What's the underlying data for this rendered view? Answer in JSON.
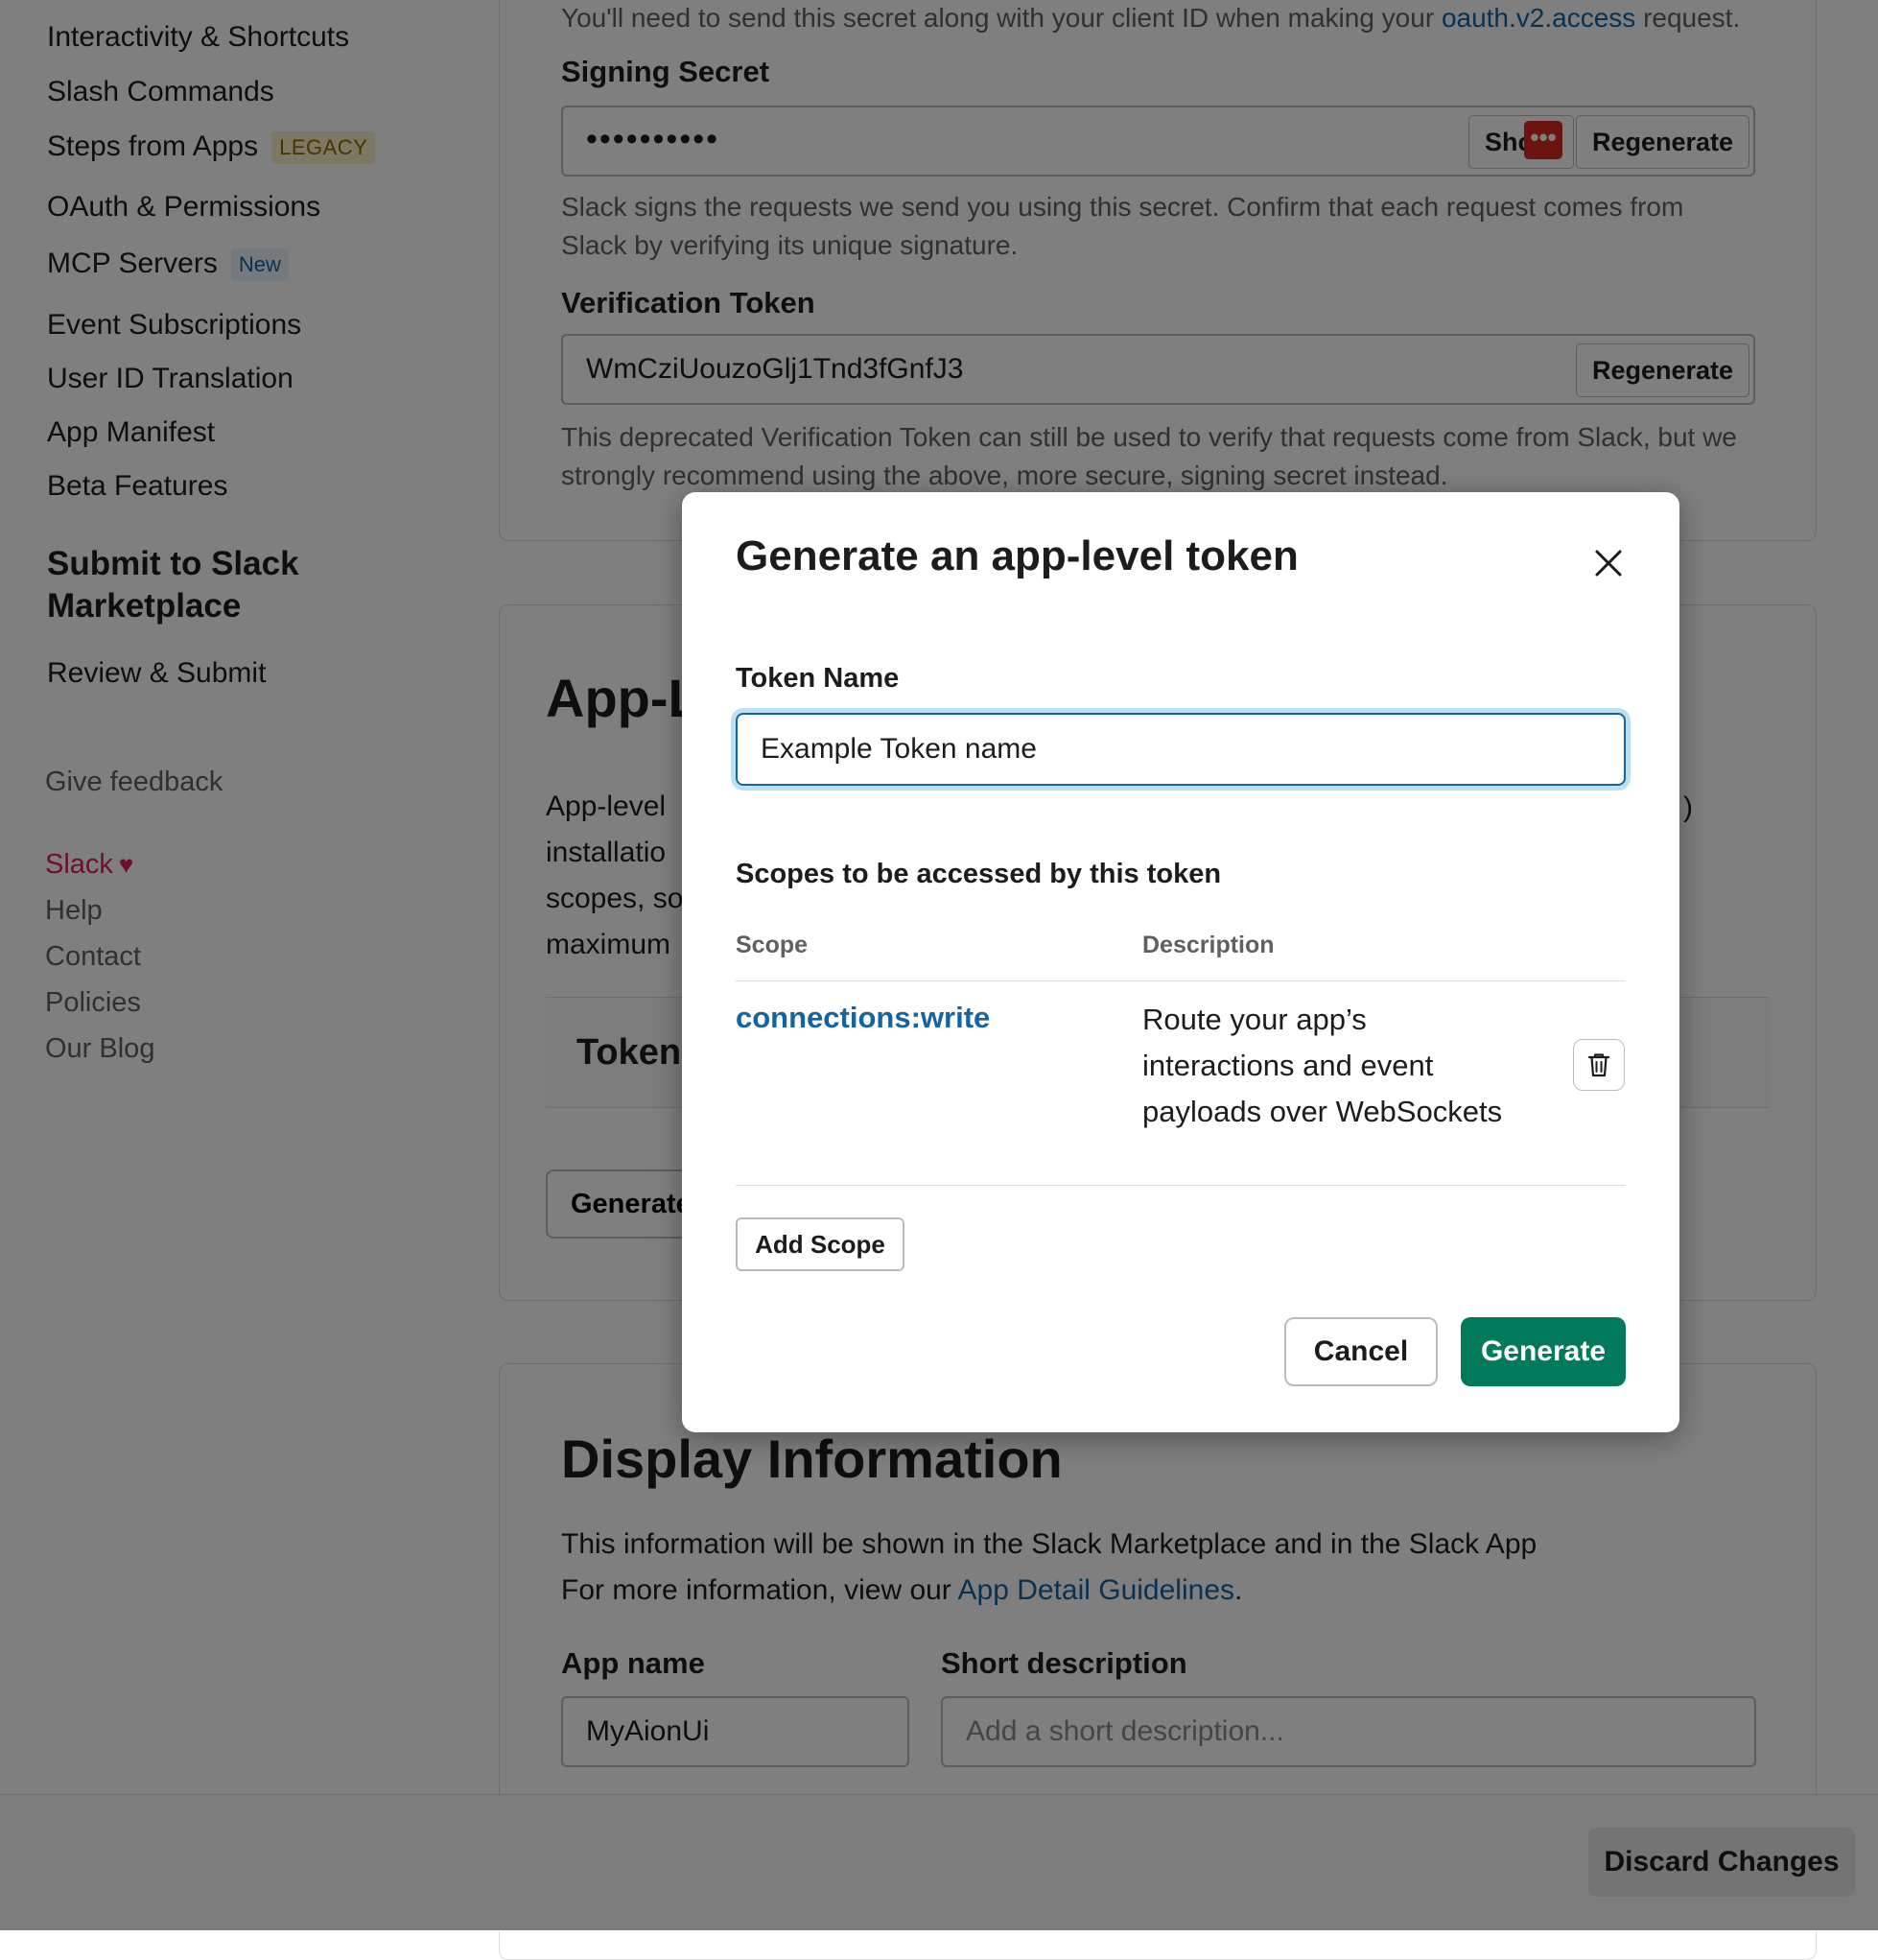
{
  "sidebar": {
    "items": [
      {
        "label": "Interactivity & Shortcuts"
      },
      {
        "label": "Slash Commands"
      },
      {
        "label": "Steps from Apps",
        "badge": "LEGACY"
      },
      {
        "label": "OAuth & Permissions"
      },
      {
        "label": "MCP Servers",
        "badge": "New"
      },
      {
        "label": "Event Subscriptions"
      },
      {
        "label": "User ID Translation"
      },
      {
        "label": "App Manifest"
      },
      {
        "label": "Beta Features"
      }
    ],
    "section_heading": "Submit to Slack Marketplace",
    "section_items": [
      {
        "label": "Review & Submit"
      }
    ],
    "feedback": "Give feedback",
    "footer": {
      "brand": "Slack",
      "links": [
        "Help",
        "Contact",
        "Policies",
        "Our Blog"
      ]
    }
  },
  "credentials": {
    "intro_text": "You'll need to send this secret along with your client ID when making your",
    "intro_link": "oauth.v2.access",
    "intro_suffix": "request.",
    "signing_secret": {
      "label": "Signing Secret",
      "value": "••••••••••",
      "show_label": "Show",
      "regenerate_label": "Regenerate",
      "help": "Slack signs the requests we send you using this secret. Confirm that each request comes from Slack by verifying its unique signature."
    },
    "verification_token": {
      "label": "Verification Token",
      "value": "WmCziUouzoGlj1Tnd3fGnfJ3",
      "regenerate_label": "Regenerate",
      "help": "This deprecated Verification Token can still be used to verify that requests come from Slack, but we strongly recommend using the above, more secure, signing secret instead."
    }
  },
  "app_level_tokens": {
    "title": "App-L",
    "body_lines": [
      "App-level",
      "installatio",
      "scopes, so",
      "maximum"
    ],
    "right_fragment": ")",
    "table_header": "Token",
    "generate_label": "Generate"
  },
  "display_info": {
    "title": "Display Information",
    "line1": "This information will be shown in the Slack Marketplace and in the Slack App",
    "line2_prefix": "For more information, view our",
    "line2_link": "App Detail Guidelines",
    "line2_suffix": ".",
    "app_name_label": "App name",
    "app_name_value": "MyAionUi",
    "short_desc_label": "Short description",
    "short_desc_placeholder": "Add a short description..."
  },
  "modal": {
    "title": "Generate an app-level token",
    "token_name_label": "Token Name",
    "token_name_value": "Example Token name",
    "scopes_heading": "Scopes to be accessed by this token",
    "columns": {
      "scope": "Scope",
      "description": "Description"
    },
    "scopes": [
      {
        "scope": "connections:write",
        "description": "Route your app’s interactions and event payloads over WebSockets"
      }
    ],
    "add_scope_label": "Add Scope",
    "cancel_label": "Cancel",
    "generate_label": "Generate"
  },
  "bottom_bar": {
    "discard_label": "Discard Changes"
  },
  "colors": {
    "accent_link": "#1264a3",
    "primary_button": "#007a5a",
    "focus_ring": "#1d9bd1",
    "brand_heart": "#e01e5a",
    "legacy_badge_bg": "#fcefc9",
    "overlay": "rgba(0,0,0,0.5)"
  },
  "icons": {
    "close": "close-icon",
    "delete": "trash-icon",
    "heart": "heart-icon",
    "more": "more-dots-icon"
  }
}
